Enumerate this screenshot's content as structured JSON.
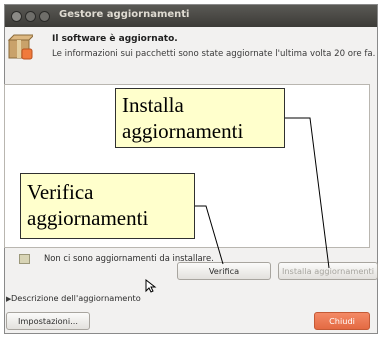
{
  "window": {
    "title": "Gestore aggiornamenti"
  },
  "header": {
    "title": "Il software è aggiornato.",
    "subtitle": "Le informazioni sui pacchetti sono state aggiornate l'ultima volta 20 ore fa."
  },
  "status": {
    "text": "Non ci sono aggiornamenti da installare."
  },
  "buttons": {
    "verifica": "Verifica",
    "installa": "Installa aggiornamenti",
    "impostazioni": "Impostazioni...",
    "chiudi": "Chiudi"
  },
  "expander": {
    "label": "Descrizione dell'aggiornamento"
  },
  "callouts": {
    "installa_line1": "Installa",
    "installa_line2": "aggiornamenti",
    "verifica_line1": "Verifica",
    "verifica_line2": "aggiornamenti"
  },
  "icons": {
    "package": "package-box-icon",
    "status": "info-folder-icon",
    "expander": "triangle-right-icon",
    "cursor": "mouse-pointer-icon"
  },
  "colors": {
    "titlebar": "#3c3b37",
    "callout_bg": "#ffffcc",
    "close_button": "#e46a43",
    "window_bg": "#f2f1f0"
  }
}
